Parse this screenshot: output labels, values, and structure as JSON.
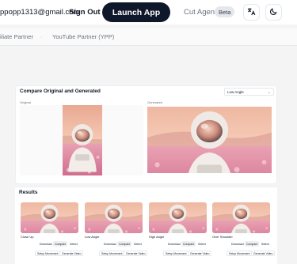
{
  "header": {
    "email": "ppopp1313@gmail.com",
    "signout_label": "Sign Out",
    "launch_label": "Launch App",
    "cutagent_label": "Cut Agent",
    "beta_badge": "Beta",
    "translate_icon": "translate-icon",
    "theme_icon": "moon-icon"
  },
  "subnav": {
    "items": [
      "iliate Partner",
      "YouTube Partner (YPP)"
    ]
  },
  "compare": {
    "title": "Compare Original and Generated",
    "angle_selected": "Low Angle",
    "original_label": "Original",
    "generated_label": "Generated"
  },
  "results": {
    "title": "Results",
    "items": [
      {
        "label": "Close Up"
      },
      {
        "label": "Low Angle"
      },
      {
        "label": "High Angle"
      },
      {
        "label": "Over Shoulder"
      }
    ],
    "download_label": "Download",
    "compare_label": "Compare",
    "select_label": "Select",
    "setup_movement_label": "Setup Movement",
    "generate_video_label": "Generate Video"
  },
  "colors": {
    "accent": "#0f172a",
    "sky": "#f2b8a0",
    "flowers": "#e68fa8"
  }
}
